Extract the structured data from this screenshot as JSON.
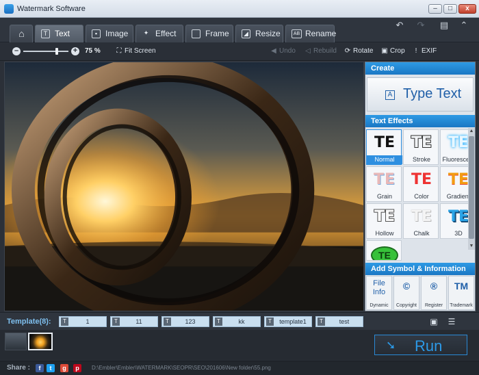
{
  "window": {
    "title": "Watermark Software"
  },
  "tabs": [
    {
      "label": "Text",
      "icon": "text-t-icon",
      "active": true
    },
    {
      "label": "Image",
      "icon": "image-icon"
    },
    {
      "label": "Effect",
      "icon": "magic-wand-icon"
    },
    {
      "label": "Frame",
      "icon": "frame-icon"
    },
    {
      "label": "Resize",
      "icon": "resize-icon"
    },
    {
      "label": "Rename",
      "icon": "ab-rename-icon"
    }
  ],
  "toolbar": {
    "zoom_percent": "75 %",
    "zoom_level": 0.75,
    "fit_screen": "Fit Screen",
    "undo": "Undo",
    "rebuild": "Rebuild",
    "rotate": "Rotate",
    "crop": "Crop",
    "exif": "EXIF"
  },
  "panel": {
    "create_header": "Create",
    "type_text": "Type Text",
    "effects_header": "Text Effects",
    "effects": [
      {
        "glyph": "TE",
        "label": "Normal",
        "selected": true
      },
      {
        "glyph": "TE",
        "label": "Stroke"
      },
      {
        "glyph": "TE",
        "label": "Fluorescent"
      },
      {
        "glyph": "TE",
        "label": "Grain"
      },
      {
        "glyph": "TE",
        "label": "Color"
      },
      {
        "glyph": "TE",
        "label": "Gradient"
      },
      {
        "glyph": "TE",
        "label": "Hollow"
      },
      {
        "glyph": "TE",
        "label": "Chalk"
      },
      {
        "glyph": "TE",
        "label": "3D"
      },
      {
        "glyph": "TE",
        "label": ""
      }
    ],
    "symbol_header": "Add Symbol & Information",
    "symbols": [
      {
        "glyph": "File Info",
        "label": "Dynamic"
      },
      {
        "glyph": "©",
        "label": "Copyright"
      },
      {
        "glyph": "®",
        "label": "Register"
      },
      {
        "glyph": "TM",
        "label": "Trademark"
      }
    ]
  },
  "templates": {
    "label": "Template(8):",
    "items": [
      "1",
      "11",
      "123",
      "kk",
      "template1",
      "test"
    ]
  },
  "run": {
    "label": "Run"
  },
  "status": {
    "share_label": "Share :",
    "path": "D:\\Embler\\Embler\\WATERMARK\\SEOPR\\SEO\\201606\\New folder\\55.png"
  },
  "colors": {
    "accent": "#2b8fe0",
    "run_text": "#2c9ae8",
    "panel_bg": "#dde3ea"
  }
}
